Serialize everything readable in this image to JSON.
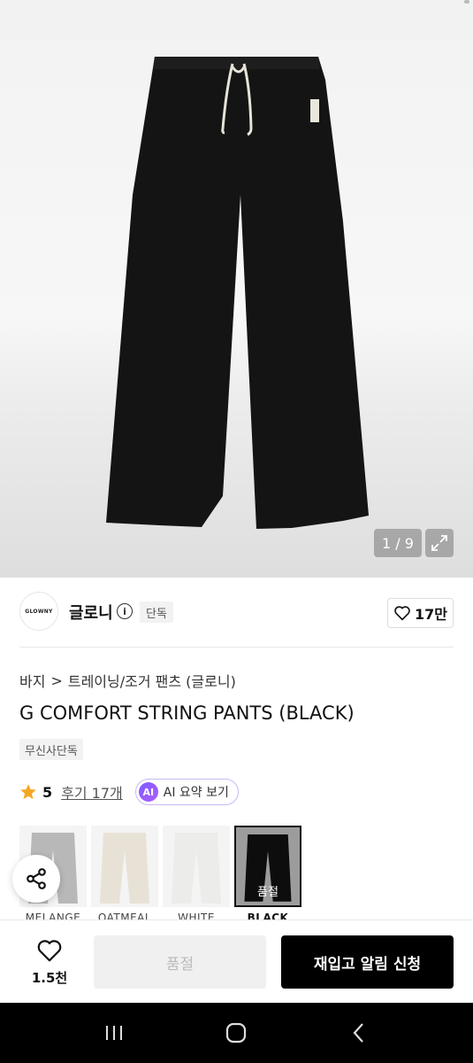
{
  "gallery": {
    "counter": "1 / 9",
    "image_alt": "black wide string pants"
  },
  "brand": {
    "logo_text": "GLOWNY",
    "name": "글로니",
    "info_icon": "info-icon",
    "badge": "단독"
  },
  "likes": {
    "count": "17만",
    "icon": "heart-outline-icon"
  },
  "breadcrumb": {
    "root": "바지",
    "separator": ">",
    "category": "트레이닝/조거 팬츠 (글로니)"
  },
  "product": {
    "title": "G COMFORT STRING PANTS (BLACK)",
    "badge": "무신사단독"
  },
  "rating": {
    "value": "5",
    "reviews": "후기 17개",
    "ai_badge": "AI",
    "ai_label": "AI 요약 보기",
    "star_color": "#f5a623"
  },
  "swatches": [
    {
      "label": "MELANGE",
      "color": "#b8b8b8",
      "selected": false
    },
    {
      "label": "OATMEAL",
      "color": "#e8e2d6",
      "selected": false
    },
    {
      "label": "WHITE",
      "color": "#f3f3f1",
      "selected": false
    },
    {
      "label": "BLACK",
      "color": "#151515",
      "selected": true,
      "status": "품절"
    }
  ],
  "bottom_bar": {
    "wish_count": "1.5천",
    "soldout_label": "품절",
    "restock_label": "재입고 알림 신청"
  },
  "colors": {
    "accent": "#000000",
    "ai_purple": "#7b5cff"
  }
}
